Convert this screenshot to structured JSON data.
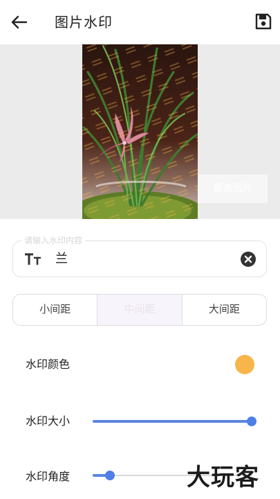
{
  "header": {
    "title": "图片水印",
    "back_icon": "arrow-left-icon",
    "save_icon": "floppy-disk-icon"
  },
  "preview": {
    "reselect_label": "重选图片"
  },
  "watermark_input": {
    "placeholder": "请输入水印内容",
    "value": "兰",
    "prefix_icon": "text-size-icon",
    "clear_icon": "clear-circle-icon"
  },
  "spacing": {
    "options": [
      "小间距",
      "中间距",
      "大间距"
    ],
    "selected": "中间距"
  },
  "settings": {
    "color": {
      "label": "水印颜色",
      "value": "#f8b54a"
    },
    "size": {
      "label": "水印大小",
      "level": 1.0
    },
    "angle": {
      "label": "水印角度",
      "level": 0.11
    }
  },
  "logo": {
    "text": "大玩客"
  },
  "colors": {
    "accent": "#4f7fe6",
    "swatch": "#f8b54a"
  }
}
